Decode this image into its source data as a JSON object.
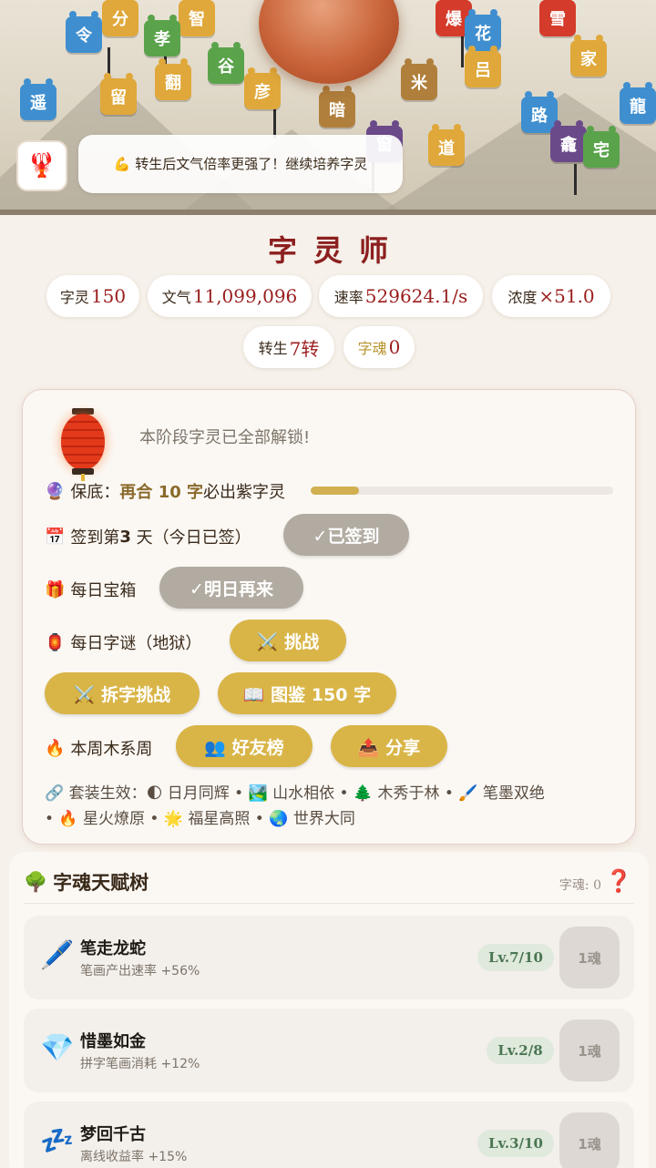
{
  "scene": {
    "toast": "💪 转生后文气倍率更强了！继续培养字灵",
    "avatar_emoji": "🦞",
    "sprites": [
      "分",
      "智",
      "爆",
      "花",
      "雪",
      "吕",
      "令",
      "孝",
      "家",
      "翻",
      "谷",
      "遥",
      "路",
      "龕",
      "宅",
      "道",
      "留",
      "窗",
      "暗",
      "米",
      "彦",
      "龍"
    ]
  },
  "header": {
    "title": "字灵师"
  },
  "stats": [
    {
      "key": "字灵",
      "value": "150"
    },
    {
      "key": "文气",
      "value": "11,099,096"
    },
    {
      "key": "速率",
      "value": "529624.1/s"
    },
    {
      "key": "浓度",
      "value": "×51.0"
    },
    {
      "key": "转生",
      "value": "7转"
    },
    {
      "key": "字魂",
      "value": "0"
    }
  ],
  "panel": {
    "unlock_text": "本阶段字灵已全部解锁!",
    "pity_icon": "🔮",
    "pity_prefix": "保底：",
    "pity_bold": "再合 10 字",
    "pity_suffix": "必出紫字灵",
    "pity_progress": 0.16,
    "checkin_icon": "📅",
    "checkin_prefix": "签到第 ",
    "checkin_day": "3",
    "checkin_suffix": " 天（今日已签）",
    "checkin_button": "✓已签到",
    "chest_icon": "🎁",
    "chest_label": "每日宝箱",
    "chest_button": "✓明日再来",
    "riddle_icon": "🏮",
    "riddle_label": "每日字谜（地狱）",
    "riddle_button": "⚔️ 挑战",
    "split_button": "⚔️ 拆字挑战",
    "codex_button": "📖 图鉴 150 字",
    "week_icon": "🔥",
    "week_label": "本周木系周",
    "friends_button": "👥 好友榜",
    "share_button": "📤 分享",
    "sets_line1": "🔗 套装生效：🌓 日月同辉 • 🏞️ 山水相依 • 🌲 木秀于林 • 🖌️ 笔墨双绝",
    "sets_line2": "• 🔥 星火燎原 • 🌟 福星高照 • 🌏 世界大同"
  },
  "tree": {
    "icon": "🌳",
    "title": "字魂天赋树",
    "soul_label": "字魂: 0",
    "help_icon": "❓",
    "items": [
      {
        "icon": "🖊️",
        "name": "笔走龙蛇",
        "desc": "笔画产出速率 +56%",
        "level": "Lv.7/10",
        "cost": "1魂"
      },
      {
        "icon": "💎",
        "name": "惜墨如金",
        "desc": "拼字笔画消耗 +12%",
        "level": "Lv.2/8",
        "cost": "1魂"
      },
      {
        "icon": "💤",
        "name": "梦回千古",
        "desc": "离线收益率 +15%",
        "level": "Lv.3/10",
        "cost": "1魂"
      }
    ]
  },
  "colors": {
    "accent_red": "#8c1f1f",
    "gold": "#d9b548",
    "grey_button": "#b1aba1"
  }
}
